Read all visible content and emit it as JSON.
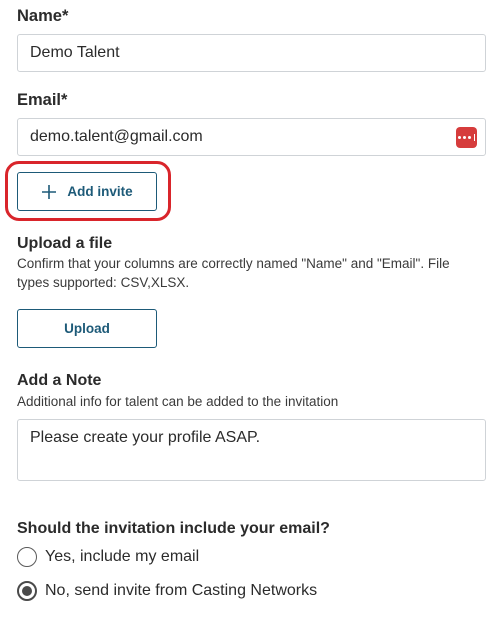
{
  "form": {
    "name_label": "Name*",
    "name_value": "Demo Talent",
    "email_label": "Email*",
    "email_value": "demo.talent@gmail.com",
    "add_invite_label": "Add invite"
  },
  "upload": {
    "title": "Upload a file",
    "helper_line1": "Confirm that your columns are correctly named \"Name\" and \"Email\". File",
    "helper_line2": "types supported: CSV,XLSX.",
    "button_label": "Upload"
  },
  "note": {
    "title": "Add a Note",
    "helper": "Additional info for talent can be added to the invitation",
    "value": "Please create your profile ASAP."
  },
  "email_option": {
    "question": "Should the invitation include your email?",
    "options": [
      {
        "label": "Yes, include my email",
        "checked": false
      },
      {
        "label": "No, send invite from Casting Networks",
        "checked": true
      }
    ]
  },
  "colors": {
    "accent": "#1d5a78",
    "highlight": "#d9252b",
    "password_manager_icon": "#d63c3c"
  },
  "icons": {
    "add_invite": "plus-icon",
    "email_field_extension": "password-manager-icon"
  }
}
